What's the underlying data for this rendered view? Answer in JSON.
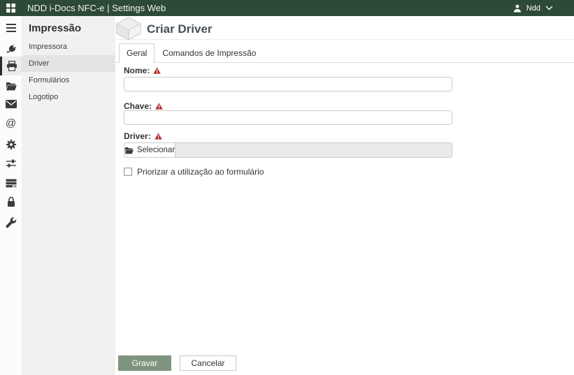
{
  "topbar": {
    "title": "NDD i-Docs NFC-e | Settings Web",
    "user_name": "Ndd",
    "icons": [
      "apps-grid-icon",
      "user-icon",
      "chevron-down-icon"
    ]
  },
  "icon_rail": {
    "active_icon": "printer-icon",
    "icons": [
      "menu-icon",
      "plug-icon",
      "printer-icon",
      "folder-open-icon",
      "mail-icon",
      "at-sign-icon",
      "gear-icon",
      "sliders-icon",
      "server-icon",
      "lock-icon",
      "wrench-icon"
    ]
  },
  "sidebar": {
    "title": "Impressão",
    "items": [
      {
        "label": "Impressora",
        "active": false
      },
      {
        "label": "Driver",
        "active": true
      },
      {
        "label": "Formulários",
        "active": false
      },
      {
        "label": "Logotipo",
        "active": false
      }
    ]
  },
  "main": {
    "title": "Criar Driver",
    "title_icon": "cube-icon",
    "tabs": [
      {
        "label": "Geral",
        "active": true
      },
      {
        "label": "Comandos de Impressão",
        "active": false
      }
    ],
    "form": {
      "fields": [
        {
          "label": "Nome:",
          "required": true,
          "value": ""
        },
        {
          "label": "Chave:",
          "required": true,
          "value": ""
        }
      ],
      "driver": {
        "label": "Driver:",
        "required": true,
        "button_label": "Selecionar",
        "icon": "folder-icon",
        "value": ""
      },
      "checkbox": {
        "label": "Priorizar a utilização ao formulário",
        "checked": false
      }
    },
    "actions": {
      "save_label": "Gravar",
      "cancel_label": "Cancelar"
    }
  },
  "colors": {
    "topbar_bg": "#2d4a37",
    "save_button_bg": "#7e947e",
    "warning": "#b22b2b",
    "sidebar_bg": "#f1f1f2",
    "active_item_bg": "#e3e3e5"
  }
}
